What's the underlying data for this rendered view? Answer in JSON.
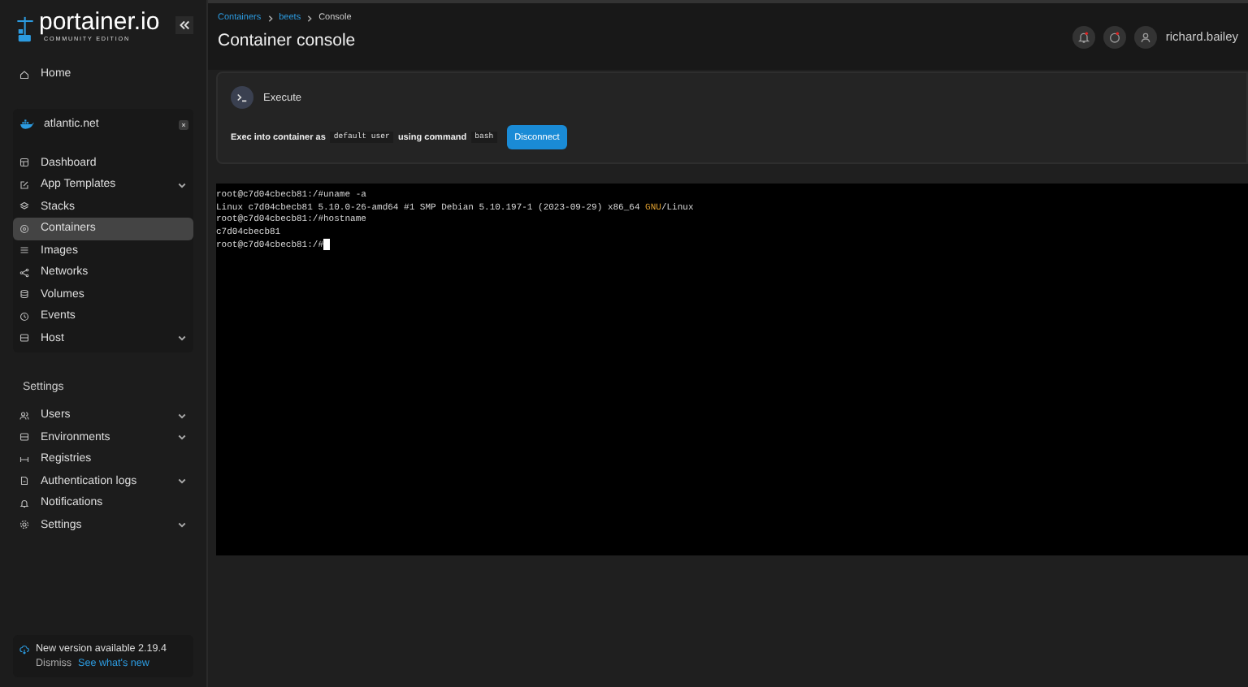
{
  "sidebar": {
    "logo": "portainer.io",
    "logo_subtitle": "COMMUNITY EDITION",
    "home": "Home",
    "environment": {
      "name": "atlantic.net",
      "items": [
        {
          "label": "Dashboard",
          "selected": false,
          "expandable": false
        },
        {
          "label": "App Templates",
          "selected": false,
          "expandable": true
        },
        {
          "label": "Stacks",
          "selected": false,
          "expandable": false
        },
        {
          "label": "Containers",
          "selected": true,
          "expandable": false
        },
        {
          "label": "Images",
          "selected": false,
          "expandable": false
        },
        {
          "label": "Networks",
          "selected": false,
          "expandable": false
        },
        {
          "label": "Volumes",
          "selected": false,
          "expandable": false
        },
        {
          "label": "Events",
          "selected": false,
          "expandable": false
        },
        {
          "label": "Host",
          "selected": false,
          "expandable": true
        }
      ]
    },
    "settings_heading": "Settings",
    "settings_items": [
      {
        "label": "Users",
        "expandable": true
      },
      {
        "label": "Environments",
        "expandable": true
      },
      {
        "label": "Registries",
        "expandable": false
      },
      {
        "label": "Authentication logs",
        "expandable": true
      },
      {
        "label": "Notifications",
        "expandable": false
      },
      {
        "label": "Settings",
        "expandable": true
      }
    ],
    "update": {
      "text": "New version available 2.19.4",
      "dismiss": "Dismiss",
      "link": "See what's new"
    }
  },
  "header": {
    "breadcrumbs": [
      "Containers",
      "beets",
      "Console"
    ],
    "title": "Container console",
    "user": "richard.bailey"
  },
  "execute": {
    "title": "Execute",
    "text_before": "Exec into container as",
    "user": "default user",
    "text_middle": "using command",
    "command": "bash",
    "button": "Disconnect"
  },
  "terminal": [
    [
      {
        "text": "root@c7d04cbecb81:/#uname -a",
        "kind": "plain"
      }
    ],
    [
      {
        "text": "Linux c7d04cbecb81 5.10.0-26-amd64 #1 SMP Debian 5.10.197-1 (2023-09-29) x86_64 ",
        "kind": "plain"
      },
      {
        "text": "GNU",
        "kind": "highlight"
      },
      {
        "text": "/Linux",
        "kind": "plain"
      }
    ],
    [
      {
        "text": "root@c7d04cbecb81:/#hostname",
        "kind": "plain"
      }
    ],
    [
      {
        "text": "c7d04cbecb81",
        "kind": "plain"
      }
    ],
    [
      {
        "text": "root@c7d04cbecb81:/#",
        "kind": "plain"
      }
    ]
  ]
}
